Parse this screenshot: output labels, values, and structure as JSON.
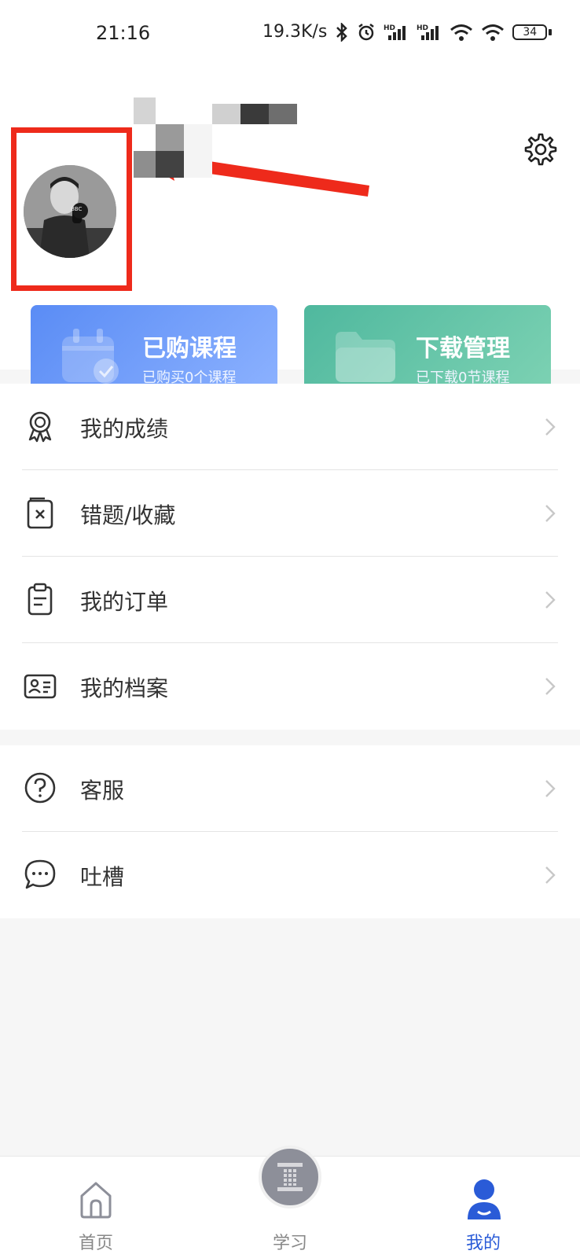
{
  "status_bar": {
    "time": "21:16",
    "network_speed": "19.3K/s",
    "battery": "34",
    "icons": [
      "bluetooth-icon",
      "alarm-icon",
      "hd-signal-icon",
      "hd-signal-icon",
      "wifi-icon",
      "wifi-hotspot-icon",
      "battery-icon"
    ]
  },
  "header": {
    "settings_icon": "gear-icon",
    "highlight_color": "#ee2a1b"
  },
  "cards": [
    {
      "title": "已购课程",
      "subtitle": "已购买0个课程",
      "icon": "calendar-check-icon",
      "color": "#5a8cf5"
    },
    {
      "title": "下载管理",
      "subtitle": "已下载0节课程",
      "icon": "folder-icon",
      "color": "#4fb89e"
    }
  ],
  "menu_section_1": [
    {
      "label": "我的成绩",
      "icon": "award-ribbon-icon"
    },
    {
      "label": "错题/收藏",
      "icon": "wrong-book-icon"
    },
    {
      "label": "我的订单",
      "icon": "clipboard-icon"
    },
    {
      "label": "我的档案",
      "icon": "id-card-icon"
    }
  ],
  "menu_section_2": [
    {
      "label": "客服",
      "icon": "help-circle-icon"
    },
    {
      "label": "吐槽",
      "icon": "chat-bubble-icon"
    }
  ],
  "bottom_nav": {
    "items": [
      {
        "label": "首页",
        "icon": "home-icon"
      },
      {
        "label": "学习",
        "icon": "study-logo-icon"
      },
      {
        "label": "我的",
        "icon": "user-icon",
        "active": true
      }
    ],
    "active_color": "#2a5bd7"
  }
}
